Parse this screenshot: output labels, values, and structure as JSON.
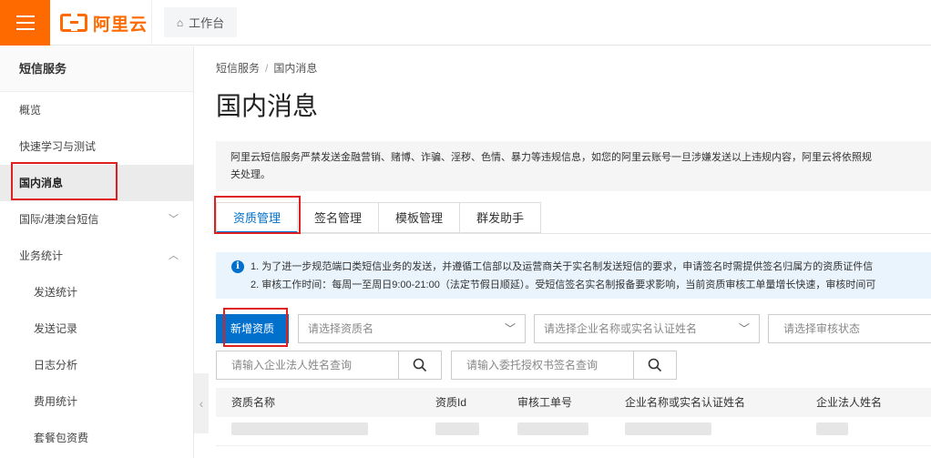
{
  "topbar": {
    "logo_text": "阿里云",
    "workbench_label": "工作台",
    "brand_color": "#ff6a00"
  },
  "sidebar": {
    "title": "短信服务",
    "items": [
      {
        "label": "概览"
      },
      {
        "label": "快速学习与测试"
      },
      {
        "label": "国内消息",
        "active": true
      },
      {
        "label": "国际/港澳台短信",
        "chevron": "chevron-down-icon"
      },
      {
        "label": "业务统计",
        "chevron": "chevron-up-icon"
      },
      {
        "label": "发送统计"
      },
      {
        "label": "发送记录"
      },
      {
        "label": "日志分析"
      },
      {
        "label": "费用统计"
      },
      {
        "label": "套餐包资费"
      }
    ]
  },
  "main": {
    "breadcrumb": [
      "短信服务",
      "国内消息"
    ],
    "breadcrumb_sep": "/",
    "title": "国内消息",
    "notice": [
      "阿里云短信服务严禁发送金融营销、赌博、诈骗、淫秽、色情、暴力等违规信息，如您的阿里云账号一旦涉嫌发送以上违规内容，阿里云将依照规",
      "关处理。"
    ],
    "tabs": [
      "资质管理",
      "签名管理",
      "模板管理",
      "群发助手"
    ],
    "info": [
      "1. 为了进一步规范端口类短信业务的发送，并遵循工信部以及运营商关于实名制发送短信的要求，申请签名时需提供签名归属方的资质证件信",
      "2. 审核工作时间：每周一至周日9:00-21:00（法定节假日顺延）。受短信签名实名制报备要求影响，当前资质审核工单量增长快速，审核时间可"
    ],
    "add_button": "新增资质",
    "select_name_placeholder": "请选择资质名",
    "select_company_placeholder": "请选择企业名称或实名认证姓名",
    "select_status_placeholder": "请选择审核状态",
    "search_legal_placeholder": "请输入企业法人姓名查询",
    "search_sign_placeholder": "请输入委托授权书签名查询",
    "table_headers": [
      "资质名称",
      "资质Id",
      "审核工单号",
      "企业名称或实名认证姓名",
      "企业法人姓名"
    ],
    "accent_color": "#0070cc"
  }
}
